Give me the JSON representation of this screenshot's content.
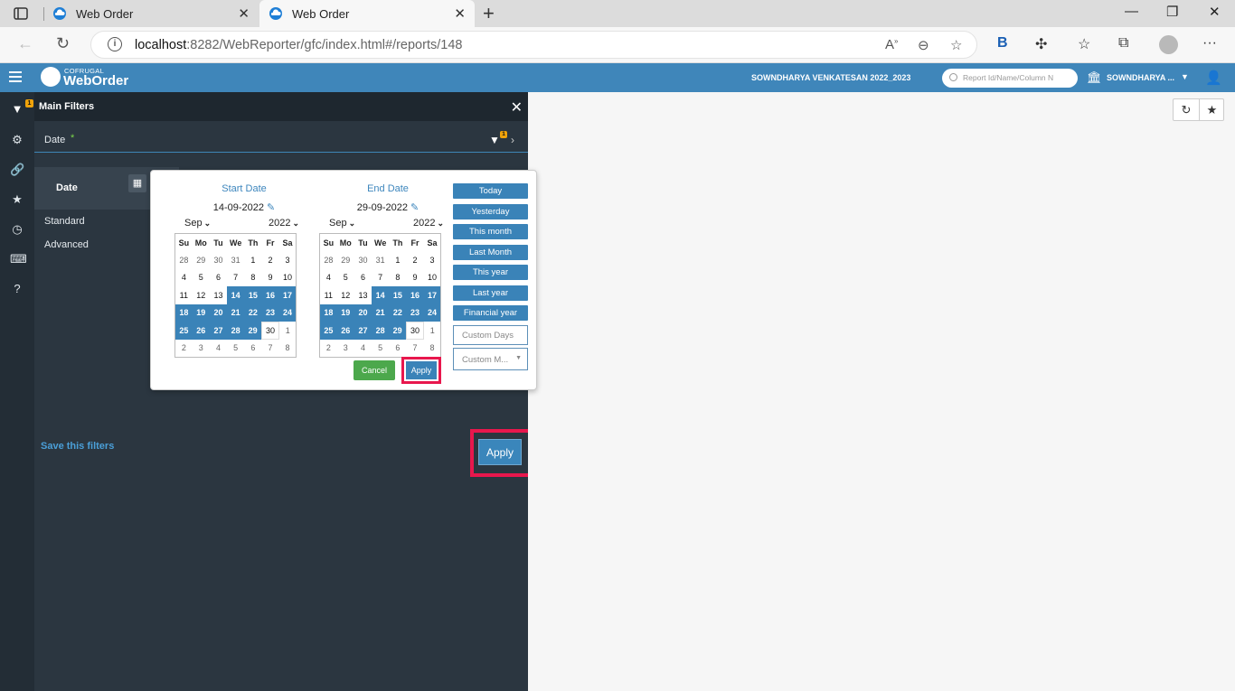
{
  "browser": {
    "tabs": [
      {
        "label": "Web Order",
        "active": false
      },
      {
        "label": "Web Order",
        "active": true
      }
    ],
    "url_host": "localhost",
    "url_rest": ":8282/WebReporter/gfc/index.html#/reports/148"
  },
  "header": {
    "logo_small": "COFRUGAL",
    "logo_big": "WebOrder",
    "user": "SOWNDHARYA VENKATESAN 2022_2023",
    "search_placeholder": "Report Id/Name/Column N",
    "company": "SOWNDHARYA ..."
  },
  "rail": {
    "filter_badge": "1"
  },
  "filters": {
    "title": "Main Filters",
    "date_label": "Date",
    "required_mark": "*",
    "filter_count": "1",
    "date_block_label": "Date",
    "options": [
      "Standard",
      "Advanced"
    ],
    "save_link": "Save this filters",
    "apply_label": "Apply"
  },
  "picker": {
    "start": {
      "title": "Start Date",
      "value": "14-09-2022",
      "month": "Sep",
      "year": "2022"
    },
    "end": {
      "title": "End Date",
      "value": "29-09-2022",
      "month": "Sep",
      "year": "2022"
    },
    "weekdays": [
      "Su",
      "Mo",
      "Tu",
      "We",
      "Th",
      "Fr",
      "Sa"
    ],
    "start_weeks": [
      [
        {
          "d": "28",
          "t": "o"
        },
        {
          "d": "29",
          "t": "o"
        },
        {
          "d": "30",
          "t": "o"
        },
        {
          "d": "31",
          "t": "o"
        },
        {
          "d": "1",
          "t": "n"
        },
        {
          "d": "2",
          "t": "n"
        },
        {
          "d": "3",
          "t": "n"
        }
      ],
      [
        {
          "d": "4",
          "t": "n"
        },
        {
          "d": "5",
          "t": "n"
        },
        {
          "d": "6",
          "t": "n"
        },
        {
          "d": "7",
          "t": "n"
        },
        {
          "d": "8",
          "t": "n"
        },
        {
          "d": "9",
          "t": "n"
        },
        {
          "d": "10",
          "t": "n"
        }
      ],
      [
        {
          "d": "11",
          "t": "n"
        },
        {
          "d": "12",
          "t": "n"
        },
        {
          "d": "13",
          "t": "n"
        },
        {
          "d": "14",
          "t": "s"
        },
        {
          "d": "15",
          "t": "s"
        },
        {
          "d": "16",
          "t": "s"
        },
        {
          "d": "17",
          "t": "s"
        }
      ],
      [
        {
          "d": "18",
          "t": "s"
        },
        {
          "d": "19",
          "t": "s"
        },
        {
          "d": "20",
          "t": "s"
        },
        {
          "d": "21",
          "t": "s"
        },
        {
          "d": "22",
          "t": "s"
        },
        {
          "d": "23",
          "t": "s"
        },
        {
          "d": "24",
          "t": "s"
        }
      ],
      [
        {
          "d": "25",
          "t": "s"
        },
        {
          "d": "26",
          "t": "s"
        },
        {
          "d": "27",
          "t": "s"
        },
        {
          "d": "28",
          "t": "s"
        },
        {
          "d": "29",
          "t": "s"
        },
        {
          "d": "30",
          "t": "w"
        },
        {
          "d": "1",
          "t": "o"
        }
      ],
      [
        {
          "d": "2",
          "t": "o"
        },
        {
          "d": "3",
          "t": "o"
        },
        {
          "d": "4",
          "t": "o"
        },
        {
          "d": "5",
          "t": "o"
        },
        {
          "d": "6",
          "t": "o"
        },
        {
          "d": "7",
          "t": "o"
        },
        {
          "d": "8",
          "t": "o"
        }
      ]
    ],
    "end_weeks": [
      [
        {
          "d": "28",
          "t": "o"
        },
        {
          "d": "29",
          "t": "o"
        },
        {
          "d": "30",
          "t": "o"
        },
        {
          "d": "31",
          "t": "o"
        },
        {
          "d": "1",
          "t": "n"
        },
        {
          "d": "2",
          "t": "n"
        },
        {
          "d": "3",
          "t": "n"
        }
      ],
      [
        {
          "d": "4",
          "t": "n"
        },
        {
          "d": "5",
          "t": "n"
        },
        {
          "d": "6",
          "t": "n"
        },
        {
          "d": "7",
          "t": "n"
        },
        {
          "d": "8",
          "t": "n"
        },
        {
          "d": "9",
          "t": "n"
        },
        {
          "d": "10",
          "t": "n"
        }
      ],
      [
        {
          "d": "11",
          "t": "n"
        },
        {
          "d": "12",
          "t": "n"
        },
        {
          "d": "13",
          "t": "n"
        },
        {
          "d": "14",
          "t": "s"
        },
        {
          "d": "15",
          "t": "s"
        },
        {
          "d": "16",
          "t": "s"
        },
        {
          "d": "17",
          "t": "s"
        }
      ],
      [
        {
          "d": "18",
          "t": "s"
        },
        {
          "d": "19",
          "t": "s"
        },
        {
          "d": "20",
          "t": "s"
        },
        {
          "d": "21",
          "t": "s"
        },
        {
          "d": "22",
          "t": "s"
        },
        {
          "d": "23",
          "t": "s"
        },
        {
          "d": "24",
          "t": "s"
        }
      ],
      [
        {
          "d": "25",
          "t": "s"
        },
        {
          "d": "26",
          "t": "s"
        },
        {
          "d": "27",
          "t": "s"
        },
        {
          "d": "28",
          "t": "s"
        },
        {
          "d": "29",
          "t": "s"
        },
        {
          "d": "30",
          "t": "w"
        },
        {
          "d": "1",
          "t": "o"
        }
      ],
      [
        {
          "d": "2",
          "t": "o"
        },
        {
          "d": "3",
          "t": "o"
        },
        {
          "d": "4",
          "t": "o"
        },
        {
          "d": "5",
          "t": "o"
        },
        {
          "d": "6",
          "t": "o"
        },
        {
          "d": "7",
          "t": "o"
        },
        {
          "d": "8",
          "t": "o"
        }
      ]
    ],
    "quick_buttons": [
      "Today",
      "Yesterday",
      "This month",
      "Last Month",
      "This year",
      "Last year",
      "Financial year"
    ],
    "custom_days_placeholder": "Custom Days",
    "custom_months_value": "Custom M...",
    "cancel_label": "Cancel",
    "apply_label": "Apply"
  },
  "colors": {
    "accent": "#3a83b8",
    "highlight": "#e8174d",
    "cancel": "#4ca84c"
  }
}
